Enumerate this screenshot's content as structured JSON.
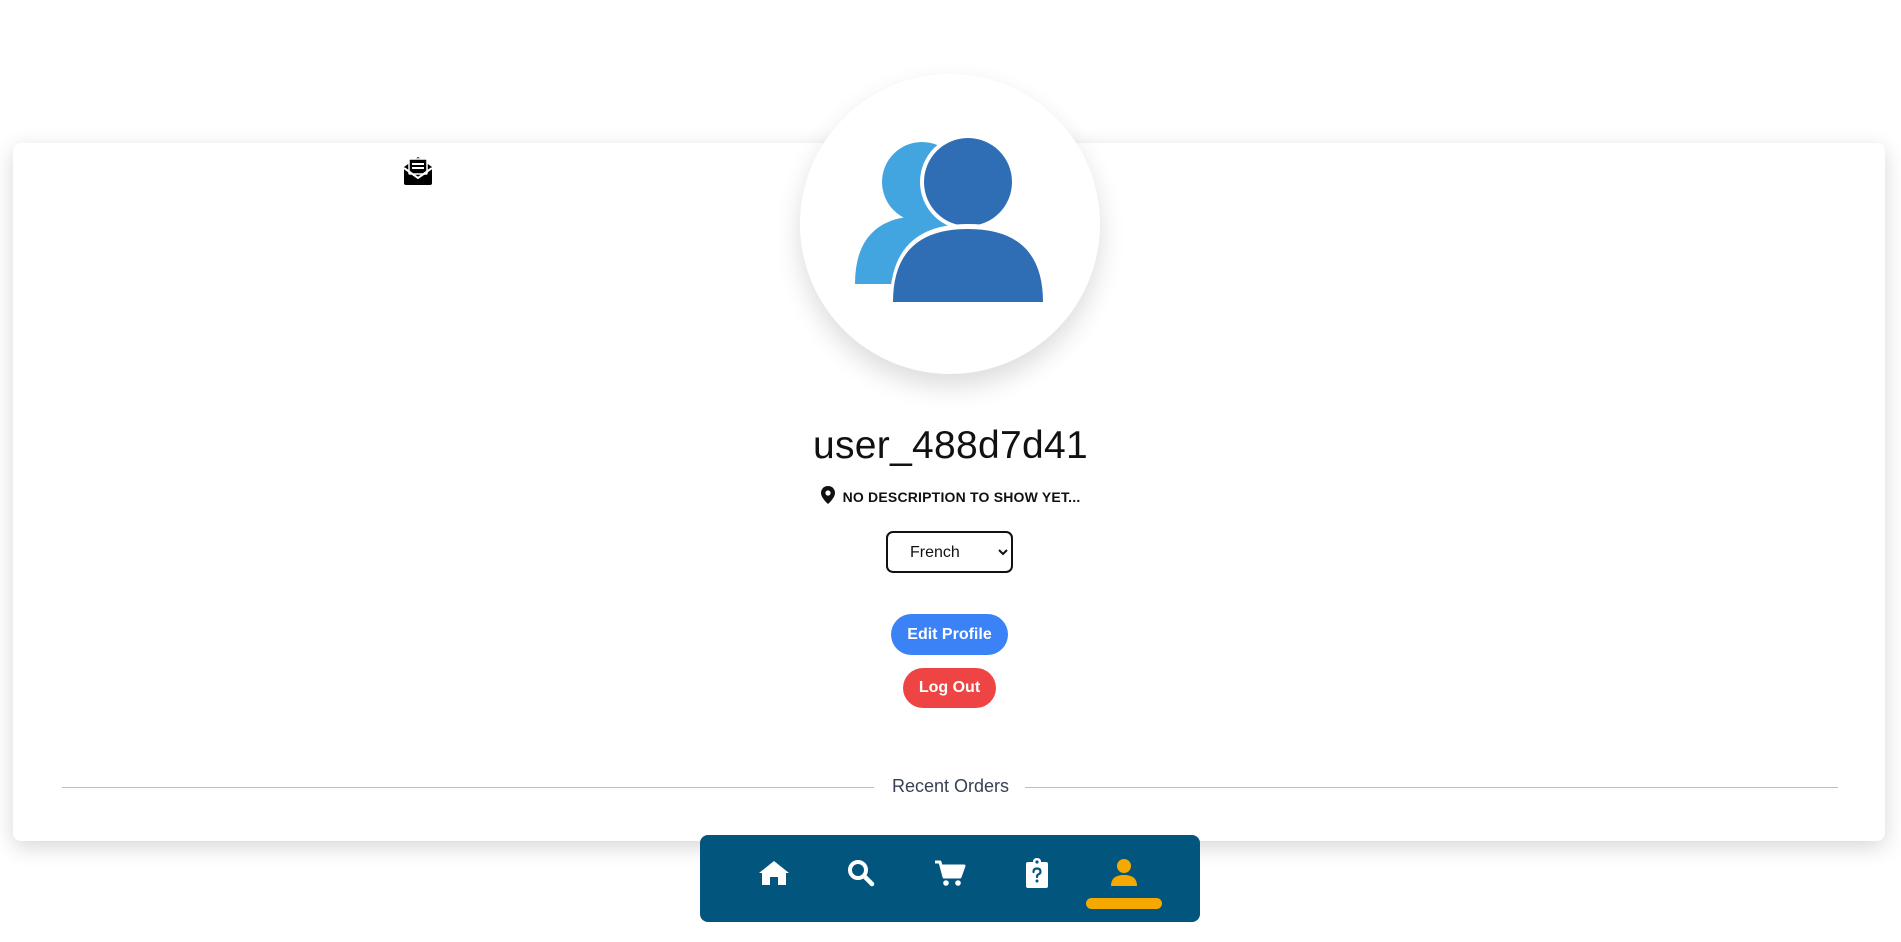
{
  "profile": {
    "username": "user_488d7d41",
    "description": "NO DESCRIPTION TO SHOW YET...",
    "avatar_icon": "users-icon",
    "mail_icon": "envelope-open-text-icon",
    "location_icon": "location-pin-icon"
  },
  "language_select": {
    "selected": "French",
    "options": [
      "French"
    ]
  },
  "actions": {
    "edit_profile_label": "Edit Profile",
    "logout_label": "Log Out"
  },
  "orders_section": {
    "label": "Recent Orders"
  },
  "bottom_nav": {
    "items": [
      {
        "icon": "home-icon",
        "active": false
      },
      {
        "icon": "search-icon",
        "active": false
      },
      {
        "icon": "cart-icon",
        "active": false
      },
      {
        "icon": "clipboard-question-icon",
        "active": false
      },
      {
        "icon": "user-icon",
        "active": true
      }
    ]
  },
  "colors": {
    "edit_button": "#3b82f6",
    "logout_button": "#ef4444",
    "nav_background": "#02557d",
    "nav_active": "#f5a800",
    "avatar_back": "#42a5e0",
    "avatar_front": "#2f6db5"
  }
}
